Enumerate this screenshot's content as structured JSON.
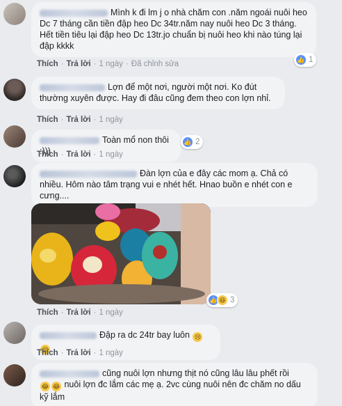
{
  "comments": [
    {
      "text": "Mình k đi lm j o nhà chăm con .năm ngoái nuôi heo Dc 7 tháng cần tiền đập heo Dc 34tr.năm nay nuôi heo Dc 3 tháng. Hết tiền tiêu lại đập heo Dc 13tr.jo chuẩn bị nuôi heo khi nào túng lại đập kkkk",
      "like_label": "Thích",
      "reply_label": "Trả lời",
      "time": "1 ngày",
      "edited": "Đã chỉnh sửa",
      "reaction_count": "1"
    },
    {
      "text": "Lợn để một nơi, người một nơi. Ko đút thường xuyên được. Hay đi đâu cũng đem theo con lợn nhỉ.",
      "like_label": "Thích",
      "reply_label": "Trả lời",
      "time": "1 ngày"
    },
    {
      "text": "Toàn mổ non thôi :)))",
      "like_label": "Thích",
      "reply_label": "Trả lời",
      "time": "1 ngày",
      "reaction_count": "2"
    },
    {
      "text": "Đàn lợn của e đây các mom ạ. Chả có nhiều. Hôm nào tâm trạng vui e nhét hết. Hnao buồn e nhét con e cưng....",
      "like_label": "Thích",
      "reply_label": "Trả lời",
      "time": "1 ngày",
      "reaction_count": "3"
    },
    {
      "text": "Đập ra dc 24tr bay luôn",
      "like_label": "Thích",
      "reply_label": "Trả lời",
      "time": "1 ngày"
    },
    {
      "text_line1": "cũng nuôi lợn nhưng thịt nó cũng lâu lâu phết rồi",
      "text_line2": "nuôi lợn đc lắm các mẹ ạ. 2vc cùng nuôi nên đc chăm no dấu kỹ lắm"
    }
  ],
  "icons": {
    "like": "like-icon",
    "haha": "haha-icon",
    "cry": "cry-emoji-icon",
    "laugh": "laugh-emoji-icon"
  },
  "colors": {
    "like_blue": "#5890ff",
    "link_gray": "#4b4f56",
    "meta_gray": "#90949c",
    "bubble_bg": "#f2f3f5"
  }
}
